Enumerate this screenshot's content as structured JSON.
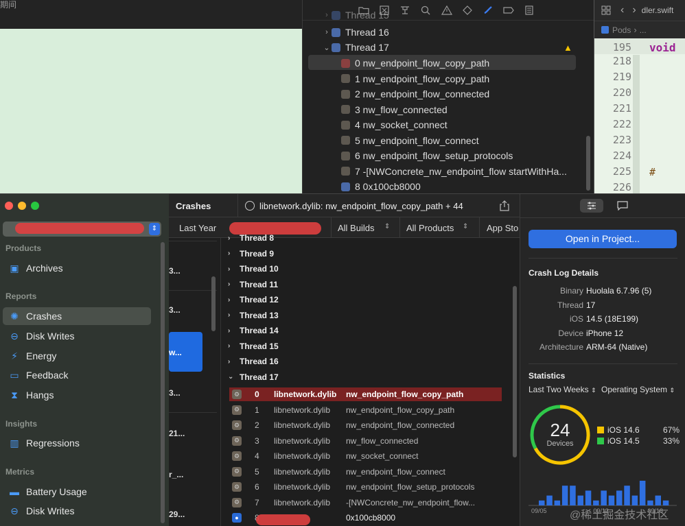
{
  "top_left": {
    "title_fragment": "期间"
  },
  "navigator": {
    "threads": [
      {
        "label": "Thread 15",
        "expanded": false
      },
      {
        "label": "Thread 16",
        "expanded": false
      },
      {
        "label": "Thread 17",
        "expanded": true
      }
    ],
    "frames": [
      "0 nw_endpoint_flow_copy_path",
      "1 nw_endpoint_flow_copy_path",
      "2 nw_endpoint_flow_connected",
      "3 nw_flow_connected",
      "4 nw_socket_connect",
      "5 nw_endpoint_flow_connect",
      "6 nw_endpoint_flow_setup_protocols",
      "7 -[NWConcrete_nw_endpoint_flow startWithHa...",
      "8 0x100cb8000"
    ]
  },
  "editor": {
    "tab": "dler.swift",
    "breadcrumb": [
      "Pods",
      "..."
    ],
    "lines": [
      "195",
      "218",
      "219",
      "220",
      "221",
      "222",
      "223",
      "224",
      "225",
      "226"
    ],
    "first_line_code": "void",
    "line_225_code": "#"
  },
  "sidebar": {
    "sections": [
      {
        "title": "Products",
        "items": [
          {
            "label": "Archives",
            "icon": "archive-icon"
          }
        ]
      },
      {
        "title": "Reports",
        "items": [
          {
            "label": "Crashes",
            "icon": "crash-icon",
            "selected": true
          },
          {
            "label": "Disk Writes",
            "icon": "disk-icon"
          },
          {
            "label": "Energy",
            "icon": "energy-icon"
          },
          {
            "label": "Feedback",
            "icon": "feedback-icon"
          },
          {
            "label": "Hangs",
            "icon": "hourglass-icon"
          }
        ]
      },
      {
        "title": "Insights",
        "items": [
          {
            "label": "Regressions",
            "icon": "chart-icon"
          }
        ]
      },
      {
        "title": "Metrics",
        "items": [
          {
            "label": "Battery Usage",
            "icon": "battery-icon"
          },
          {
            "label": "Disk Writes",
            "icon": "disk-icon"
          }
        ]
      }
    ]
  },
  "crash_list": {
    "items": [
      "3...",
      "3...",
      "w...",
      "3...",
      "21...",
      "r_...",
      "29..."
    ]
  },
  "header": {
    "title": "Crashes",
    "crash_title": "libnetwork.dylib: nw_endpoint_flow_copy_path + 44"
  },
  "filters": {
    "period": "Last Year",
    "builds": "All Builds",
    "products": "All Products",
    "store": "App Sto"
  },
  "threads": {
    "collapsed": [
      "Thread 8",
      "Thread 9",
      "Thread 10",
      "Thread 11",
      "Thread 12",
      "Thread 13",
      "Thread 14",
      "Thread 15",
      "Thread 16"
    ],
    "expanded": "Thread 17",
    "frames": [
      {
        "index": "0",
        "library": "libnetwork.dylib",
        "symbol": "nw_endpoint_flow_copy_path"
      },
      {
        "index": "1",
        "library": "libnetwork.dylib",
        "symbol": "nw_endpoint_flow_copy_path"
      },
      {
        "index": "2",
        "library": "libnetwork.dylib",
        "symbol": "nw_endpoint_flow_connected"
      },
      {
        "index": "3",
        "library": "libnetwork.dylib",
        "symbol": "nw_flow_connected"
      },
      {
        "index": "4",
        "library": "libnetwork.dylib",
        "symbol": "nw_socket_connect"
      },
      {
        "index": "5",
        "library": "libnetwork.dylib",
        "symbol": "nw_endpoint_flow_connect"
      },
      {
        "index": "6",
        "library": "libnetwork.dylib",
        "symbol": "nw_endpoint_flow_setup_protocols"
      },
      {
        "index": "7",
        "library": "libnetwork.dylib",
        "symbol": "-[NWConcrete_nw_endpoint_flow..."
      },
      {
        "index": "8",
        "library": "",
        "symbol": "0x100cb8000"
      }
    ]
  },
  "inspector": {
    "open_button": "Open in Project...",
    "details_title": "Crash Log Details",
    "details": [
      {
        "key": "Binary",
        "value": "Huolala 6.7.96 (5)"
      },
      {
        "key": "Thread",
        "value": "17"
      },
      {
        "key": "iOS",
        "value": "14.5 (18E199)"
      },
      {
        "key": "Device",
        "value": "iPhone 12"
      },
      {
        "key": "Architecture",
        "value": "ARM-64 (Native)"
      }
    ],
    "stats_title": "Statistics",
    "stats_period": "Last Two Weeks",
    "stats_group": "Operating System",
    "device_count": "24",
    "device_label": "Devices",
    "legend": [
      {
        "label": "iOS 14.6",
        "pct": "67%",
        "color": "#f5c400"
      },
      {
        "label": "iOS 14.5",
        "pct": "33%",
        "color": "#2fc84a"
      }
    ],
    "date_ticks": [
      "09/05",
      "09/12",
      "09/18"
    ]
  },
  "chart_data": {
    "type": "bar",
    "title": "",
    "values": [
      1,
      2,
      1,
      4,
      4,
      2,
      3,
      1,
      3,
      2,
      3,
      4,
      2,
      5,
      1,
      2,
      1
    ],
    "x_ticks": [
      "09/05",
      "09/12",
      "09/18"
    ]
  },
  "donut": {
    "type": "pie",
    "values": [
      67,
      33
    ],
    "labels": [
      "iOS 14.6",
      "iOS 14.5"
    ],
    "colors": [
      "#f5c400",
      "#2fc84a"
    ]
  },
  "watermark": "@稀土掘金技术社区",
  "colors": {
    "accent": "#2f6fe0",
    "crash_row": "#7a2222",
    "redaction": "#e04040"
  }
}
